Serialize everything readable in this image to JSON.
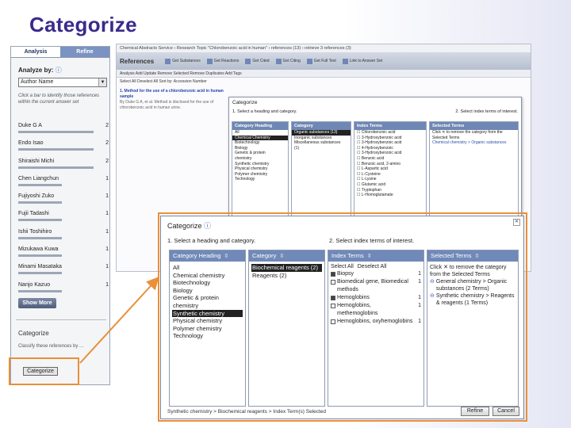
{
  "slide_title": "Categorize",
  "sidebar": {
    "tabs": [
      "Analysis",
      "Refine"
    ],
    "analyze_by_label": "Analyze by:",
    "analyze_select": "Author Name",
    "hint": "Click a bar to identify those references within the current answer set",
    "authors": [
      {
        "name": "Duke G A",
        "count": "2",
        "bar": 0.95
      },
      {
        "name": "Endo Isao",
        "count": "2",
        "bar": 0.95
      },
      {
        "name": "Shiraishi Michi",
        "count": "2",
        "bar": 0.95
      },
      {
        "name": "Chen Liangchun",
        "count": "1",
        "bar": 0.55
      },
      {
        "name": "Fujiyoshi Zuko",
        "count": "1",
        "bar": 0.55
      },
      {
        "name": "Fujii Tadashi",
        "count": "1",
        "bar": 0.55
      },
      {
        "name": "Ishii Toshihiro",
        "count": "1",
        "bar": 0.55
      },
      {
        "name": "Mizukawa Kuwa",
        "count": "1",
        "bar": 0.55
      },
      {
        "name": "Minami Masataka",
        "count": "1",
        "bar": 0.55
      },
      {
        "name": "Nanjo Kazuo",
        "count": "1",
        "bar": 0.55
      }
    ],
    "show_more": "Show More",
    "categorize_title": "Categorize",
    "categorize_hint": "Classify these references by ...",
    "categorize_button": "Categorize"
  },
  "background": {
    "breadcrumb": "Chemical Abstracts Service › Research Topic \"Chlorobenzoic acid in human\" › references (13) › retrieve 3 references (3)",
    "toolbar_title": "References",
    "toolbar_items": [
      "Get Substances",
      "Get Reactions",
      "Get Cited",
      "Get Citing",
      "Get Full Text",
      "Link to Answer Set"
    ],
    "actions": "Analysis  Add Update  Remove Selected  Remove Duplicates  Add Tags",
    "selrow": "Select All  Deselect All   Sort by: Accession Number",
    "results_title": "1. Method for the use of a chlorobenzoic acid in human sample",
    "results_text": "By Duke G A, et al. Method is disclosed for the use of chlorobenzoic acid in human urine.",
    "dialog_title": "Categorize",
    "step1": "1. Select a heading and category.",
    "step2": "2. Select index terms of interest.",
    "headings": [
      "All",
      "Chemical Chemistry",
      "Biotechnology",
      "Biology",
      "Genetic & protein",
      "chemistry",
      "Synthetic chemistry",
      "Physical chemistry",
      "Polymer chemistry",
      "Technology"
    ],
    "categories": [
      "Organic substances (13)",
      "Inorganic substances",
      "Miscellaneous substances",
      "(1)"
    ],
    "index_terms": [
      "Chlorobenzoic acid",
      "3-Hydroxybenzoic acid",
      "3-Hydroxybenzoic acid",
      "4-Hydroxybenzoic",
      "3-Hydroxybenzoic acid",
      "Benzoic acid",
      "Benzoic acid, 2-amino",
      "L-Aspartic acid",
      "L-Cysteine",
      "L-Lysine",
      "Glutamic acid",
      "Tryptophan",
      "L-Homoglutamate"
    ],
    "selected_desc": "Click ✕ to remove the category from the Selected Terms",
    "selected_term": "Chemical chemistry > Organic substances"
  },
  "dialog": {
    "title": "Categorize",
    "step1": "1. Select a heading and category.",
    "step2": "2. Select index terms of interest.",
    "columns": {
      "heading": "Category Heading",
      "category": "Category",
      "index": "Index Terms",
      "selected": "Selected Terms"
    },
    "headings": [
      "All",
      "Chemical chemistry",
      "Biotechnology",
      "Biology",
      "Genetic & protein",
      "chemistry",
      "Synthetic chemistry",
      "Physical chemistry",
      "Polymer chemistry",
      "Technology"
    ],
    "selected_heading_index": 6,
    "categories": [
      "Biochemical reagents (2)",
      "Reagents (2)"
    ],
    "index_select_all": "Select All",
    "index_deselect_all": "Deselect All",
    "index_terms": [
      {
        "label": "Biopsy",
        "count": "1",
        "checked": true,
        "indent": false
      },
      {
        "label": "Biomedical gene, Biomedical",
        "count": "1",
        "checked": false,
        "indent": false
      },
      {
        "label": "methods",
        "count": "",
        "checked": false,
        "indent": true
      },
      {
        "label": "Hemoglobins",
        "count": "1",
        "checked": true,
        "indent": false
      },
      {
        "label": "Hemoglobins,",
        "count": "1",
        "checked": false,
        "indent": false
      },
      {
        "label": "methemoglobins",
        "count": "",
        "checked": false,
        "indent": true
      },
      {
        "label": "Hemoglobins, oxyhemoglobins",
        "count": "1",
        "checked": false,
        "indent": false
      }
    ],
    "selected_desc": "Click ✕ to remove the category from the Selected Terms",
    "selected_terms": [
      "General chemistry > Organic substances (2 Terms)",
      "Synthetic chemistry > Reagents & reagents (1 Terms)"
    ],
    "footer": "Synthetic chemistry > Biochemical reagents > Index Term(s) Selected",
    "refine_button": "Refine",
    "cancel_button": "Cancel"
  },
  "colors": {
    "title": "#3b2a8c",
    "highlight": "#e8903a",
    "column_header": "#7089b8"
  }
}
